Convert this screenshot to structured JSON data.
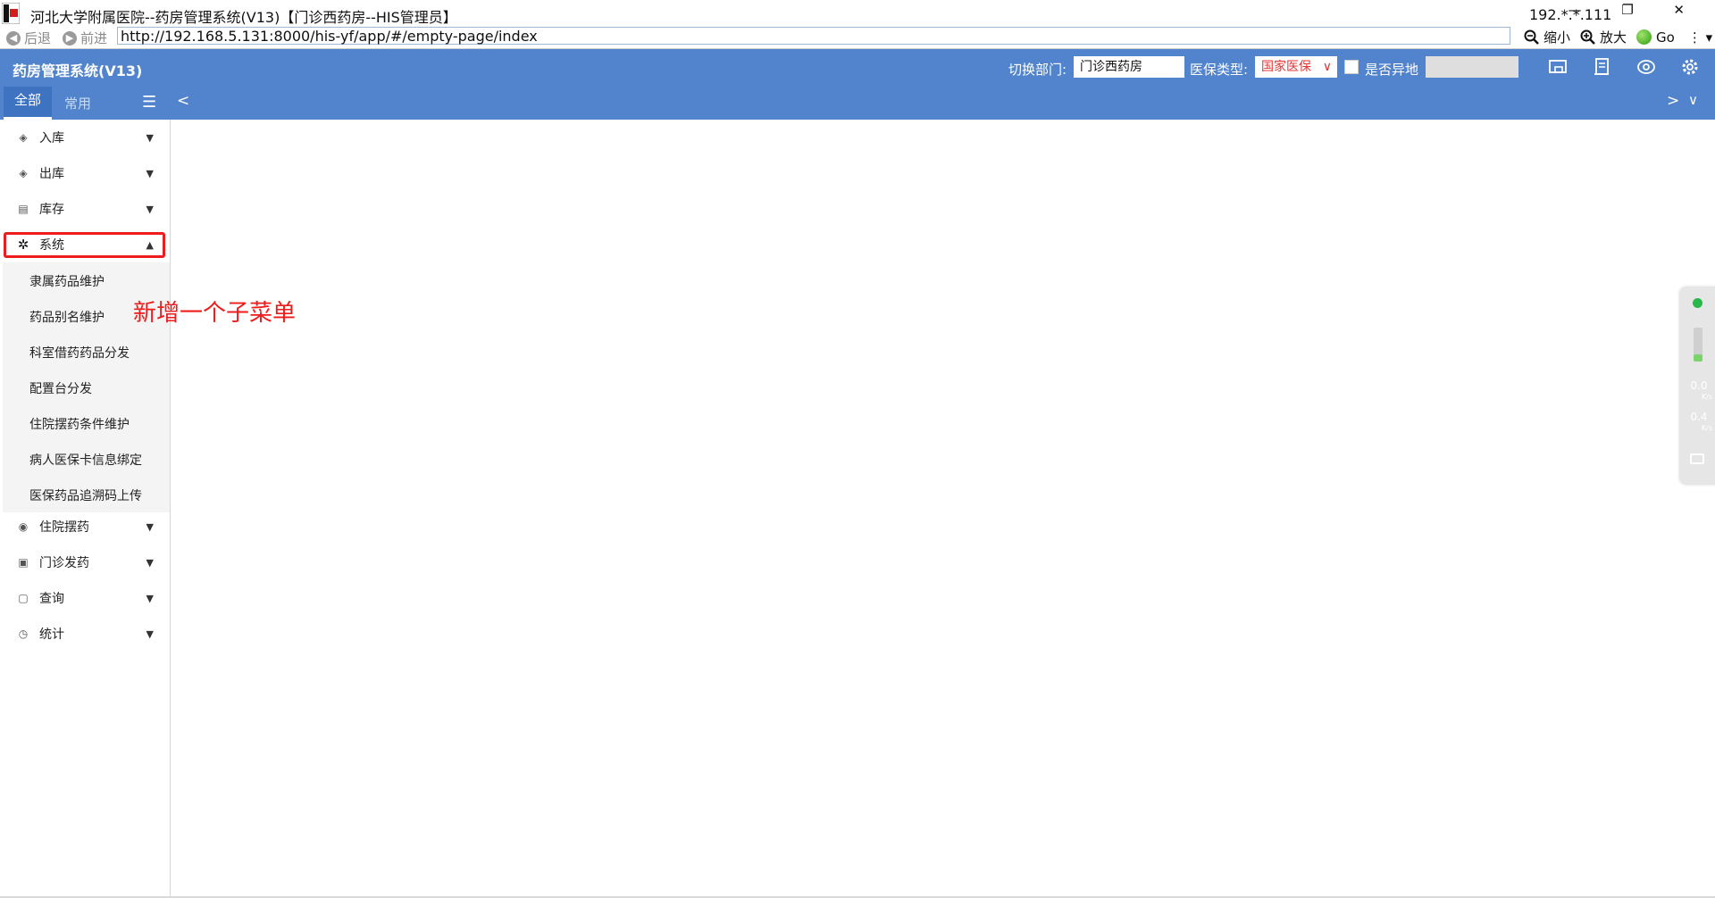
{
  "window": {
    "title": "河北大学附属医院--药房管理系统(V13)【门诊西药房--HIS管理员】",
    "ip": "192.*.*.111",
    "controls": "— ❐ ✕"
  },
  "browser": {
    "back_label": "后退",
    "forward_label": "前进",
    "url": "http://192.168.5.131:8000/his-yf/app/#/empty-page/index",
    "zoom_out_label": "缩小",
    "zoom_in_label": "放大",
    "go_label": "Go",
    "menu_label": "⋮ ▾"
  },
  "header": {
    "system_title": "药房管理系统(V13)",
    "switch_dept_label": "切换部门:",
    "dept_value": "门诊西药房",
    "insurance_type_label": "医保类型:",
    "insurance_type_value": "国家医保",
    "remote_label": "是否异地",
    "icons": [
      "screen-icon",
      "document-icon",
      "eye-swap-icon",
      "gear-icon"
    ]
  },
  "tabs": {
    "all_label": "全部",
    "fav_label": "常用"
  },
  "sidebar": {
    "items": [
      {
        "label": "入库"
      },
      {
        "label": "出库"
      },
      {
        "label": "库存"
      },
      {
        "label": "系统"
      },
      {
        "label": "住院摆药"
      },
      {
        "label": "门诊发药"
      },
      {
        "label": "查询"
      },
      {
        "label": "统计"
      }
    ],
    "system_subitems": [
      "隶属药品维护",
      "药品别名维护",
      "科室借药药品分发",
      "配置台分发",
      "住院摆药条件维护",
      "病人医保卡信息绑定",
      "医保药品追溯码上传"
    ]
  },
  "annotation": {
    "text": "新增一个子菜单",
    "color": "#ee1c1c"
  },
  "float_widget": {
    "upload_value": "0.0",
    "upload_unit": "K/s",
    "download_value": "0.4",
    "download_unit": "K/s"
  },
  "colors": {
    "header_blue": "#5184cc",
    "active_tab": "#3e73c1",
    "highlight_red": "#ee1c1c"
  }
}
